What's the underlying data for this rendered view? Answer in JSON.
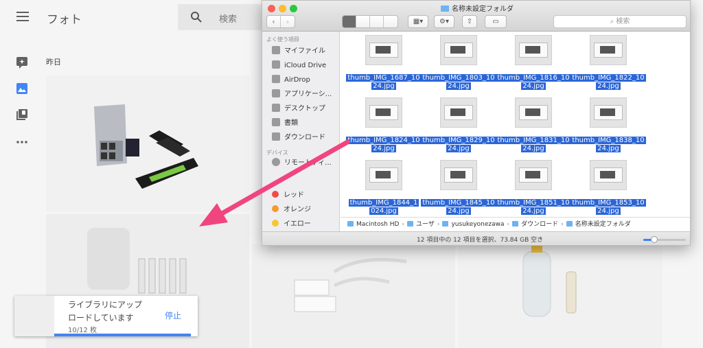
{
  "photos_app": {
    "title": "フォト",
    "search_placeholder": "検索",
    "date_label": "昨日",
    "rail_icons": [
      "assistant-icon",
      "photos-icon",
      "albums-icon",
      "more-icon"
    ]
  },
  "upload_toast": {
    "line1": "ライブラリにアップ",
    "line2": "ロードしています",
    "stop_label": "停止",
    "count": "10/12 枚",
    "progress": 0.83,
    "accent": "#4285f4"
  },
  "finder": {
    "window_title": "名称未設定フォルダ",
    "search_placeholder": "検索",
    "sidebar": {
      "favorites_header": "よく使う項目",
      "favorites": [
        {
          "label": "マイファイル",
          "icon": "all-files-icon"
        },
        {
          "label": "iCloud Drive",
          "icon": "cloud-icon"
        },
        {
          "label": "AirDrop",
          "icon": "airdrop-icon"
        },
        {
          "label": "アプリケーシ...",
          "icon": "applications-icon"
        },
        {
          "label": "デスクトップ",
          "icon": "desktop-icon"
        },
        {
          "label": "書類",
          "icon": "documents-icon"
        },
        {
          "label": "ダウンロード",
          "icon": "downloads-icon"
        }
      ],
      "devices_header": "デバイス",
      "devices": [
        {
          "label": "リモートディ...",
          "icon": "remote-disc-icon"
        }
      ],
      "tags": [
        {
          "label": "レッド",
          "color": "#f04b4b"
        },
        {
          "label": "オレンジ",
          "color": "#f59a2b"
        },
        {
          "label": "イエロー",
          "color": "#f5c92b"
        }
      ]
    },
    "files": [
      {
        "line1": "thumb_IMG_1687_10",
        "line2": "24.jpg"
      },
      {
        "line1": "thumb_IMG_1803_10",
        "line2": "24.jpg"
      },
      {
        "line1": "thumb_IMG_1816_10",
        "line2": "24.jpg"
      },
      {
        "line1": "thumb_IMG_1822_10",
        "line2": "24.jpg"
      },
      {
        "line1": "thumb_IMG_1824_10",
        "line2": "24.jpg"
      },
      {
        "line1": "thumb_IMG_1829_10",
        "line2": "24.jpg"
      },
      {
        "line1": "thumb_IMG_1831_10",
        "line2": "24.jpg"
      },
      {
        "line1": "thumb_IMG_1838_10",
        "line2": "24.jpg"
      },
      {
        "line1": "thumb_IMG_1844_1",
        "line2": "024.jpg"
      },
      {
        "line1": "thumb_IMG_1845_10",
        "line2": "24.jpg"
      },
      {
        "line1": "thumb_IMG_1851_10",
        "line2": "24.jpg"
      },
      {
        "line1": "thumb_IMG_1853_10",
        "line2": "24.jpg"
      }
    ],
    "path": [
      "Macintosh HD",
      "ユーザ",
      "yusukeyonezawa",
      "ダウンロード",
      "名称未設定フォルダ"
    ],
    "status": "12 項目中の 12 項目を選択、73.84 GB 空き",
    "selection_color": "#2b66d7"
  }
}
